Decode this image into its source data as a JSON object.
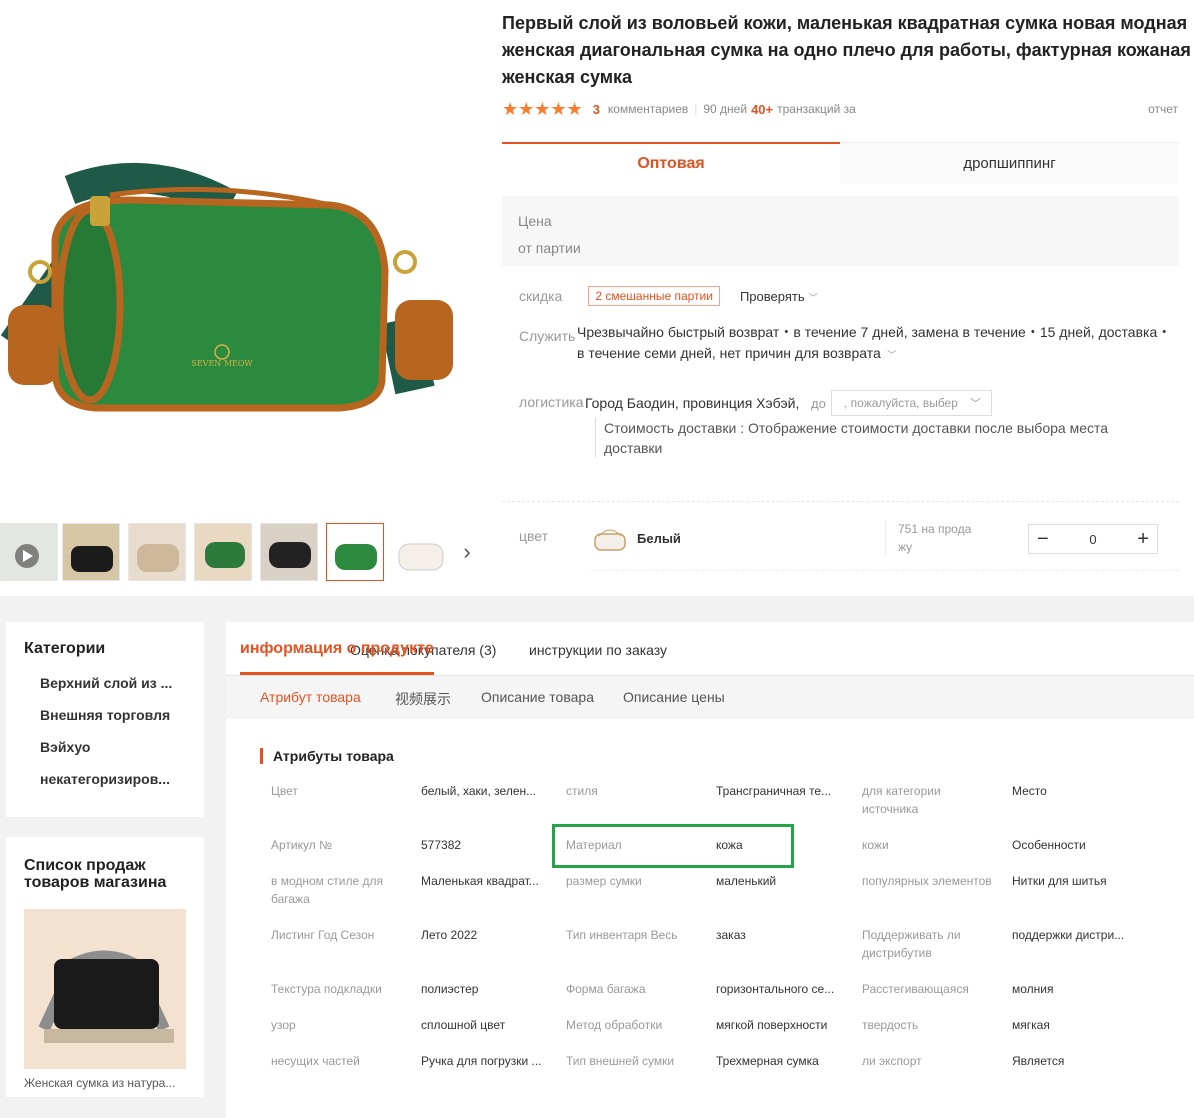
{
  "product": {
    "title": "Первый слой из воловьей кожи, маленькая квадратная сумка новая модная женская диагональная сумка на одно плечо для работы, фактурная кожаная женская сумка",
    "rating_stars": "★★★★★",
    "rating_value": 4.5,
    "comments_count": "3",
    "comments_label": "комментариев",
    "period_label": "90 дней",
    "transactions_count": "40+",
    "transactions_label": "транзакций за",
    "report_label": "отчет"
  },
  "main_image": {
    "brand_text": "SEVEN MEOW",
    "bag_color": "#2b8a3e"
  },
  "thumbnails": [
    {
      "name": "thumb-1",
      "color": "#e4e6e2"
    },
    {
      "name": "thumb-2",
      "color": "#1b1b1b"
    },
    {
      "name": "thumb-3",
      "color": "#d8c8b4"
    },
    {
      "name": "thumb-4",
      "color": "#2c7a3c"
    },
    {
      "name": "thumb-5",
      "color": "#222222"
    },
    {
      "name": "thumb-6",
      "color": "#2b8a3e"
    },
    {
      "name": "thumb-7",
      "color": "#f4efe8"
    }
  ],
  "purchase_tabs": {
    "wholesale": "Оптовая",
    "dropshipping": "дропшиппинг"
  },
  "price": {
    "label": "Цена",
    "batch_label": "от партии"
  },
  "discount": {
    "label": "скидка",
    "badge": "2 смешанные партии",
    "check": "Проверять"
  },
  "service": {
    "label": "Служить",
    "text": "Чрезвычайно быстрый возврат・в течение 7 дней, замена в течение・15 дней, доставка・в течение семи дней, нет причин для возврата"
  },
  "logistics": {
    "label": "логистика",
    "city": "Город Баодин, провинция Хэбэй,",
    "to": "до",
    "select_placeholder": ", пожалуйста, выбер",
    "shipping_text": "Стоимость доставки : Отображение стоимости доставки после выбора места доставки"
  },
  "color_option": {
    "label": "цвет",
    "name": "Белый",
    "stock": "751 на продажу",
    "stock_line1": "751 на прода",
    "stock_line2": "жу",
    "quantity": "0",
    "minus": "−",
    "plus": "+"
  },
  "sidebar": {
    "categories_title": "Категории",
    "categories": [
      "Верхний слой из ...",
      "Внешняя торговля",
      "Вэйхуо",
      "некатегоризиров..."
    ],
    "sales_title": "Список продаж товаров магазина",
    "sales_caption": "Женская сумка из натура..."
  },
  "info_tabs": {
    "product_info": "информация о продукте",
    "buyer_reviews": "Оценка покупателя (3)",
    "order_instructions": "инструкции по заказу"
  },
  "sub_tabs": [
    "Атрибут товара",
    "视频展示",
    "Описание товара",
    "Описание цены"
  ],
  "attributes_title": "Атрибуты товара",
  "attributes": [
    [
      "Цвет",
      "белый, хаки, зелен...",
      "стиля",
      "Трансграничная те...",
      "для категории источника",
      "Место"
    ],
    [
      "Артикул №",
      "577382",
      "Материал",
      "кожа",
      "кожи",
      "Особенности"
    ],
    [
      "в модном стиле для багажа",
      "Маленькая квадрат...",
      "размер сумки",
      "маленький",
      "популярных элементов",
      "Нитки для шитья"
    ],
    [
      "Листинг Год Сезон",
      "Лето 2022",
      "Тип инвентаря Весь",
      "заказ",
      "Поддерживать ли дистрибутив",
      "поддержки дистри..."
    ],
    [
      "Текстура подкладки",
      "полиэстер",
      "Форма багажа",
      "горизонтального се...",
      "Расстегивающаяся",
      "молния"
    ],
    [
      "узор",
      "сплошной цвет",
      "Метод обработки",
      "мягкой поверхности",
      "твердость",
      "мягкая"
    ],
    [
      "несущих частей",
      "Ручка для погрузки ...",
      "Тип внешней сумки",
      "Трехмерная сумка",
      "ли экспорт",
      "Является"
    ]
  ],
  "colors": {
    "accent": "#e6521f",
    "highlight": "#27a347",
    "star": "#ff7b2c"
  }
}
